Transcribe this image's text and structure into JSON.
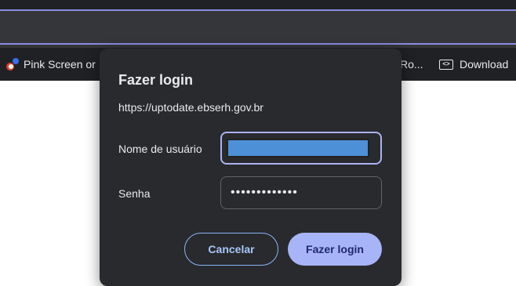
{
  "bookmarks": [
    {
      "label": "Pink Screen or",
      "icon": "flower-icon"
    },
    {
      "label": "Ro...",
      "icon": ""
    },
    {
      "label": "Download",
      "icon": "download-badge-icon",
      "icon_text": "<>"
    }
  ],
  "dialog": {
    "title": "Fazer login",
    "url": "https://uptodate.ebserh.gov.br",
    "username_label": "Nome de usuário",
    "username_value": "",
    "password_label": "Senha",
    "password_value": "•••••••••••••",
    "cancel_label": "Cancelar",
    "login_label": "Fazer login"
  },
  "colors": {
    "dialog_bg": "#292a2d",
    "accent": "#a8b4f8",
    "focus_border": "#a8b4f2",
    "autofill": "#4d90d8"
  }
}
